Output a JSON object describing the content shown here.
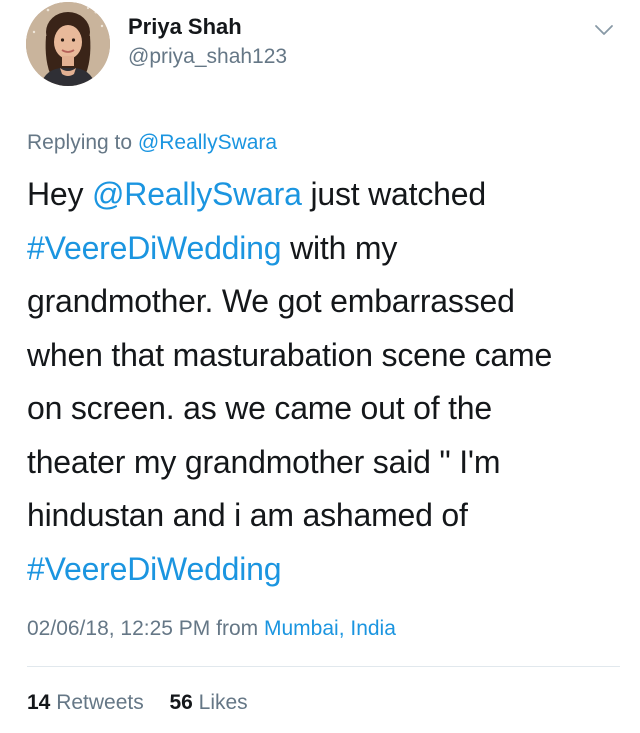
{
  "user": {
    "name": "Priya Shah",
    "handle": "@priya_shah123"
  },
  "reply": {
    "prefix": "Replying to",
    "mention": "@ReallySwara"
  },
  "tweet": {
    "line1_a": "Hey",
    "line1_mention": "@ReallySwara",
    "line1_b": "just watched",
    "line2_hashtag": "#VeereDiWedding",
    "line2_b": "with my",
    "line3": "grandmother. We got embarrassed",
    "line4": "when that masturabation scene came",
    "line5": "on screen. as we came out of the",
    "line6": "theater my grandmother said \" I'm",
    "line7": "hindustan and i am ashamed of",
    "line8_hashtag": "#VeereDiWedding"
  },
  "meta": {
    "datetime": "02/06/18, 12:25 PM",
    "from_label": "from",
    "location": "Mumbai, India"
  },
  "stats": {
    "retweets_count": "14",
    "retweets_label": "Retweets",
    "likes_count": "56",
    "likes_label": "Likes"
  },
  "icons": {
    "menu": "chevron-down-icon",
    "avatar": "avatar"
  },
  "colors": {
    "link": "#1b95e0",
    "secondary": "#657786",
    "primary": "#14171a",
    "divider": "#e1e8ed"
  }
}
